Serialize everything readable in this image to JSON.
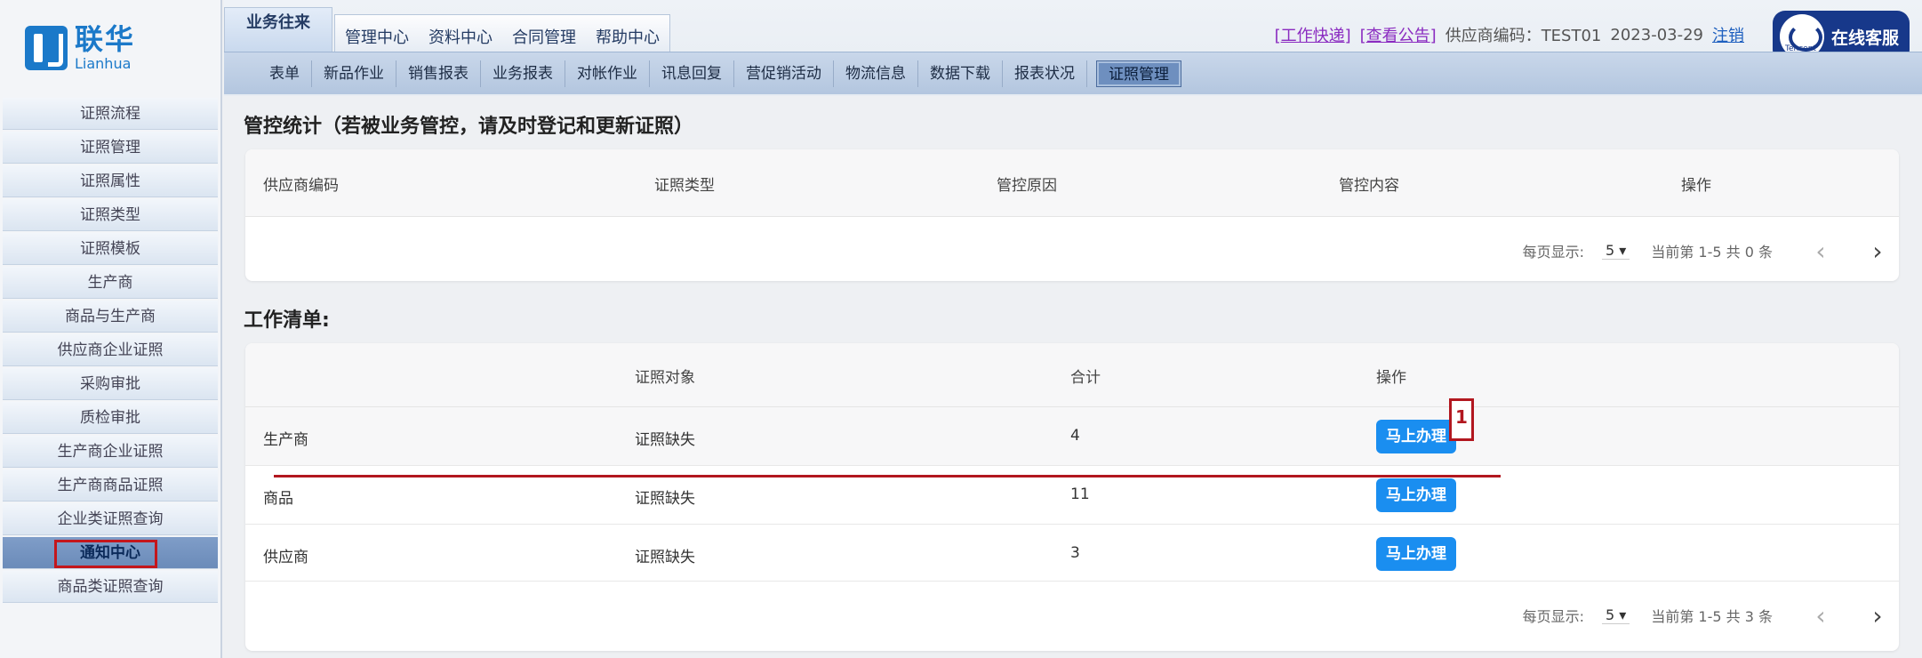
{
  "logo": {
    "cn": "联华",
    "en": "Lianhua"
  },
  "sidebar": {
    "items": [
      "证照流程",
      "证照管理",
      "证照属性",
      "证照类型",
      "证照模板",
      "生产商",
      "商品与生产商",
      "供应商企业证照",
      "采购审批",
      "质检审批",
      "生产商企业证照",
      "生产商商品证照",
      "企业类证照查询",
      "通知中心",
      "商品类证照查询"
    ],
    "active_index": 13
  },
  "header": {
    "tabs": [
      "业务往来",
      "管理中心",
      "资料中心",
      "合同管理",
      "帮助中心"
    ],
    "active_tab": 0,
    "links": {
      "work_express": "工作快递",
      "notice": "查看公告"
    },
    "supplier_code_label": "供应商编码：",
    "supplier_code": "TEST01",
    "date": "2023-03-29",
    "logout": "注销",
    "support": {
      "label": "在线客服",
      "brand": "Tencent"
    }
  },
  "subnav": {
    "items": [
      "表单",
      "新品作业",
      "销售报表",
      "业务报表",
      "对帐作业",
      "讯息回复",
      "营促销活动",
      "物流信息",
      "数据下载",
      "报表状况",
      "证照管理"
    ],
    "active_index": 10
  },
  "control_stats": {
    "title": "管控统计（若被业务管控，请及时登记和更新证照）",
    "columns": [
      "供应商编码",
      "证照类型",
      "管控原因",
      "管控内容",
      "操作"
    ],
    "pager": {
      "per_page_label": "每页显示:",
      "per_page": "5",
      "status": "当前第 1-5 共 0 条"
    }
  },
  "worklist": {
    "title": "工作清单:",
    "columns": [
      "",
      "证照对象",
      "合计",
      "操作"
    ],
    "rows": [
      {
        "name": "生产商",
        "object": "证照缺失",
        "total": "4",
        "action": "马上办理"
      },
      {
        "name": "商品",
        "object": "证照缺失",
        "total": "11",
        "action": "马上办理"
      },
      {
        "name": "供应商",
        "object": "证照缺失",
        "total": "3",
        "action": "马上办理"
      }
    ],
    "pager": {
      "per_page_label": "每页显示:",
      "per_page": "5",
      "status": "当前第 1-5 共 3 条"
    }
  },
  "annotation": {
    "marker": "1"
  }
}
